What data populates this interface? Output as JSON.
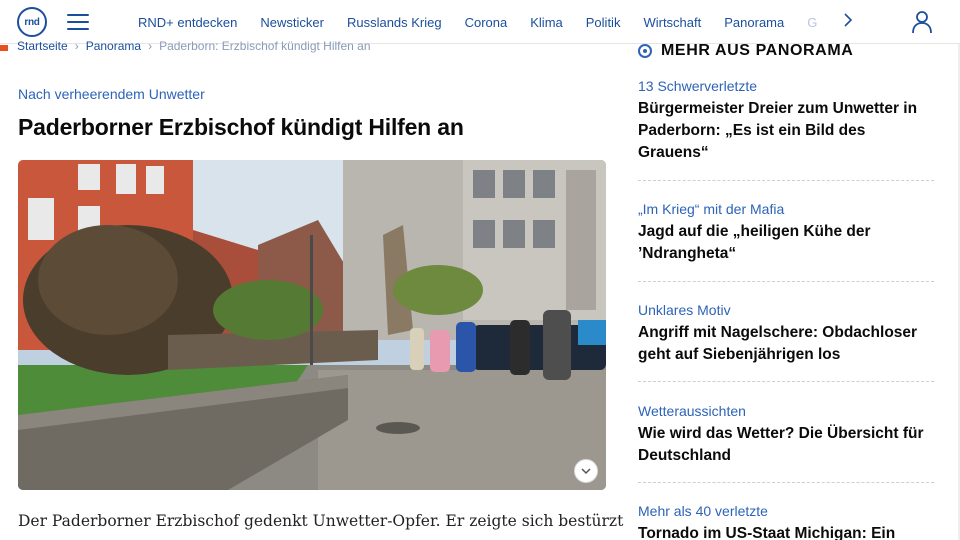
{
  "nav": {
    "logo_text": "rnd",
    "links": [
      "RND+ entdecken",
      "Newsticker",
      "Russlands Krieg",
      "Corona",
      "Klima",
      "Politik",
      "Wirtschaft",
      "Panorama",
      "Gesu"
    ],
    "next_icon": "chevron-right-icon",
    "user_icon": "user-icon",
    "menu_icon": "hamburger-icon"
  },
  "breadcrumb": {
    "items": [
      "Startseite",
      "Panorama",
      "Paderborn: Erzbischof kündigt Hilfen an"
    ]
  },
  "article": {
    "kicker": "Nach verheerendem Unwetter",
    "headline": "Paderborner Erzbischof kündigt Hilfen an",
    "teaser": "Der Paderborner Erzbischof gedenkt Unwetter-Opfer. Er zeigte sich bestürzt",
    "image_icon": "chevron-down-icon"
  },
  "sidebar": {
    "title": "MEHR AUS PANORAMA",
    "items": [
      {
        "kicker": "13 Schwerverletzte",
        "title": "Bürgermeister Dreier zum Unwetter in Paderborn: „Es ist ein Bild des Grauens“"
      },
      {
        "kicker": "„Im Krieg“ mit der Mafia",
        "title": "Jagd auf die „heiligen Kühe der ’Ndrangheta“"
      },
      {
        "kicker": "Unklares Motiv",
        "title": "Angriff mit Nagelschere: Obdachloser geht auf Siebenjährigen los"
      },
      {
        "kicker": "Wetteraussichten",
        "title": "Wie wird das Wetter? Die Übersicht für Deutschland"
      },
      {
        "kicker": "Mehr als 40 verletzte",
        "title": "Tornado im US-Staat Michigan: Ein"
      }
    ]
  },
  "colors": {
    "brand_blue": "#1b4f9c",
    "kicker_blue": "#2d63b8",
    "accent_orange": "#e2531f"
  }
}
